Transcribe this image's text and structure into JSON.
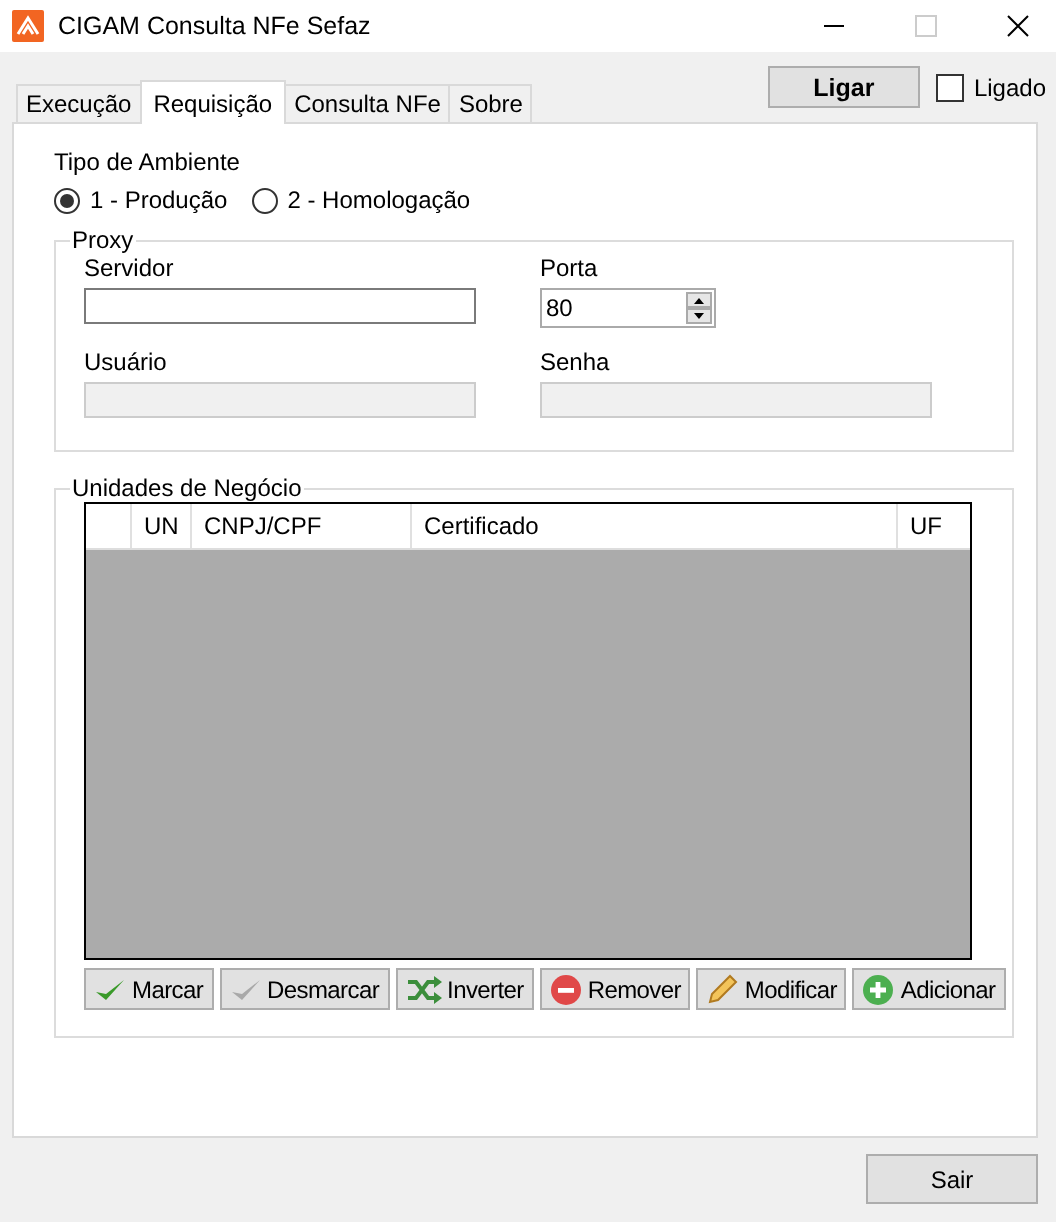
{
  "window": {
    "title": "CIGAM Consulta NFe Sefaz",
    "maximize_disabled": true
  },
  "tabs": [
    {
      "label": "Execução",
      "selected": false
    },
    {
      "label": "Requisição",
      "selected": true
    },
    {
      "label": "Consulta NFe",
      "selected": false
    },
    {
      "label": "Sobre",
      "selected": false
    }
  ],
  "connect_button": "Ligar",
  "connected": {
    "label": "Ligado",
    "checked": false
  },
  "environment": {
    "label": "Tipo de Ambiente",
    "options": [
      {
        "label": "1 - Produção",
        "selected": true
      },
      {
        "label": "2 - Homologação",
        "selected": false
      }
    ]
  },
  "proxy": {
    "title": "Proxy",
    "fields": [
      {
        "kind": "text",
        "label": "Servidor",
        "disabled": false
      },
      {
        "kind": "spin",
        "label": "Porta",
        "value": "80",
        "disabled": false
      },
      {
        "kind": "text",
        "label": "Usuário",
        "disabled": true
      },
      {
        "kind": "text",
        "label": "Senha",
        "disabled": true
      }
    ]
  },
  "business_units": {
    "title": "Unidades de Negócio",
    "table": {
      "columns": [
        "UN",
        "CNPJ/CPF",
        "Certificado",
        "UF"
      ]
    },
    "buttons": [
      {
        "kind": "check",
        "label": "Marcar"
      },
      {
        "kind": "uncheck",
        "label": "Desmarcar"
      },
      {
        "kind": "invert",
        "label": "Inverter"
      },
      {
        "kind": "remove",
        "label": "Remover"
      },
      {
        "kind": "edit",
        "label": "Modificar"
      },
      {
        "kind": "add",
        "label": "Adicionar"
      }
    ]
  },
  "exit_button": "Sair"
}
